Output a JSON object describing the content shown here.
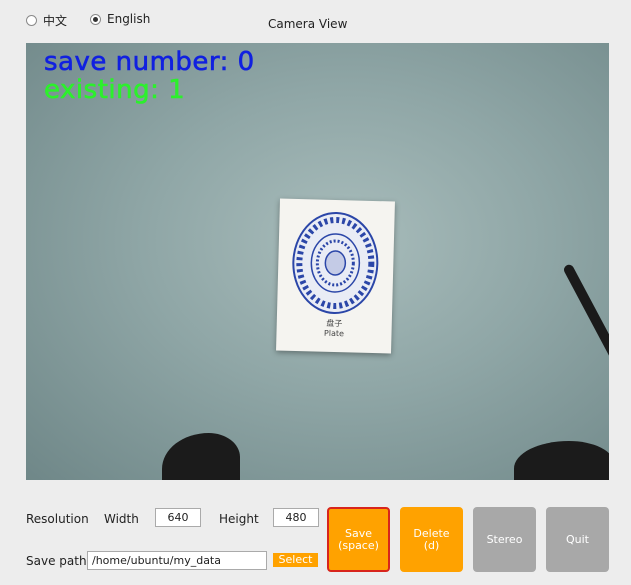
{
  "language": {
    "options": [
      {
        "label": "中文",
        "checked": false
      },
      {
        "label": "English",
        "checked": true
      }
    ]
  },
  "title": "Camera View",
  "overlay": {
    "save_number": "save number: 0",
    "existing": "existing: 1"
  },
  "scene": {
    "label_cn": "盘子",
    "label_en": "Plate"
  },
  "settings": {
    "resolution_label": "Resolution",
    "width_label": "Width",
    "width_value": "640",
    "height_label": "Height",
    "height_value": "480",
    "save_path_label": "Save path",
    "save_path_value": "/home/ubuntu/my_data",
    "select_label": "Select"
  },
  "buttons": {
    "save": {
      "line1": "Save",
      "line2": "(space)"
    },
    "delete": {
      "line1": "Delete",
      "line2": "(d)"
    },
    "stereo": "Stereo",
    "quit": "Quit"
  },
  "colors": {
    "accent": "#ffa200",
    "disabled": "#a8a8a8",
    "focus_border": "#d8251c",
    "overlay_save": "#1020e0",
    "overlay_existing": "#2cf02c"
  }
}
